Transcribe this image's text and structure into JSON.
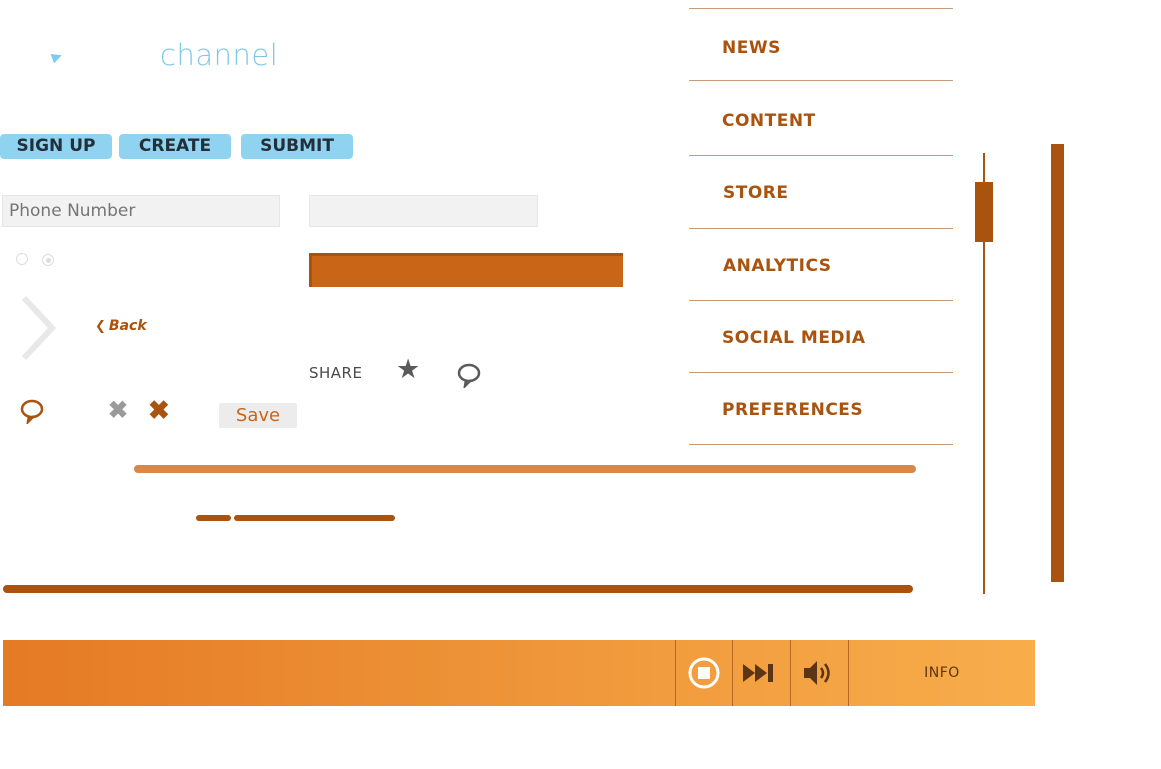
{
  "logo": {
    "text": "channel",
    "icon": "play-triangle-icon"
  },
  "buttons": {
    "signup": "SIGN UP",
    "create": "CREATE",
    "submit": "SUBMIT"
  },
  "form": {
    "phone_placeholder": "Phone Number",
    "second_value": ""
  },
  "back_label": "Back",
  "share": {
    "label": "SHARE",
    "icons": [
      "star-icon",
      "comment-icon"
    ]
  },
  "save_label": "Save",
  "menu": {
    "items": [
      {
        "label": "NEWS"
      },
      {
        "label": "CONTENT"
      },
      {
        "label": "STORE"
      },
      {
        "label": "ANALYTICS"
      },
      {
        "label": "SOCIAL MEDIA"
      },
      {
        "label": "PREFERENCES"
      }
    ]
  },
  "player": {
    "info_label": "INFO",
    "icons": [
      "stop-icon",
      "skip-forward-icon",
      "volume-icon"
    ]
  },
  "colors": {
    "accent": "#a9530f",
    "orange": "#c96517",
    "blue": "#8fd3f0",
    "player_start": "#e57a24",
    "player_end": "#f8ad4b"
  }
}
